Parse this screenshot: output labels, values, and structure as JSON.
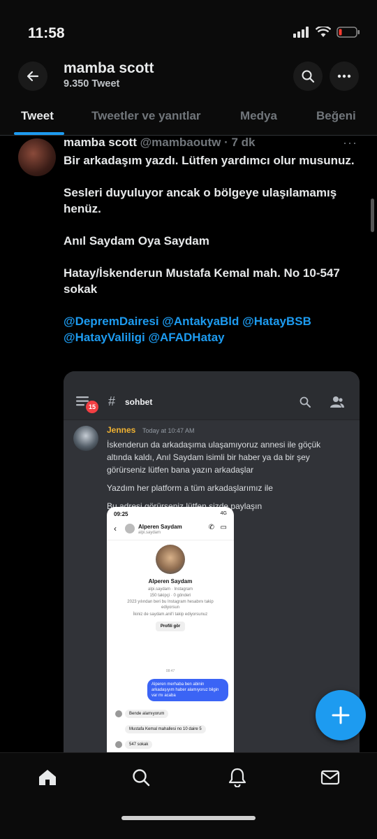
{
  "status": {
    "time": "11:58"
  },
  "header": {
    "name": "mamba scott",
    "tweet_count": "9.350 Tweet"
  },
  "tabs": [
    {
      "label": "Tweet",
      "active": true
    },
    {
      "label": "Tweetler ve yanıtlar"
    },
    {
      "label": "Medya"
    },
    {
      "label": "Beğeni"
    }
  ],
  "tweet": {
    "author": "mamba scott",
    "handle_time": "@mambaoutw · 7 dk",
    "paragraphs": [
      "Bir arkadaşım yazdı. Lütfen yardımcı olur musunuz.",
      "Sesleri duyuluyor ancak o bölgeye ulaşılamamış henüz.",
      "Anıl Saydam Oya Saydam",
      "Hatay/İskenderun Mustafa Kemal mah. No 10-547 sokak"
    ],
    "mentions": "@DepremDairesi @AntakyaBld @HatayBSB @HatayValiligi @AFADHatay"
  },
  "discord": {
    "badge": "15",
    "channel": "sohbet",
    "author": "Jennes",
    "time": "Today at 10:47 AM",
    "lines": [
      "İskenderun da arkadaşıma ulaşamıyoruz annesi ile göçük altında kaldı, Anıl Saydam isimli bir haber ya da bir şey görürseniz lütfen bana yazın arkadaşlar",
      "Yazdım her platform a tüm arkadaşlarımız ile",
      "Bu adresi görürseniz lütfen sizde paylaşın"
    ]
  },
  "phone": {
    "time": "09:25",
    "status_right": "4G",
    "name": "Alperen Saydam",
    "username": "alpi.saydam",
    "profile_name": "Alperen Saydam",
    "profile_user": "alpi.saydam · Instagram",
    "stats": "150 takipçi · 0 gönderi",
    "since": "2023 yılından beri bu Instagram hesabını takip ediyorsun",
    "mutual": "İkiniz de saydam.anil'i takip ediyorsunuz",
    "profile_btn": "Profili gör",
    "date": "08:47",
    "out_msg": "Alperen merhaba ben abinin arkadaşıyım haber alamıyoruz bilgin var mı acaba",
    "in1": "Bende alamıyorum",
    "in2": "Mustafa Kemal mahallesi no 10 daire 5",
    "in3": "547 sokak"
  },
  "colors": {
    "accent": "#1d9bf0",
    "background": "#000000",
    "discord_bg": "#313338"
  }
}
